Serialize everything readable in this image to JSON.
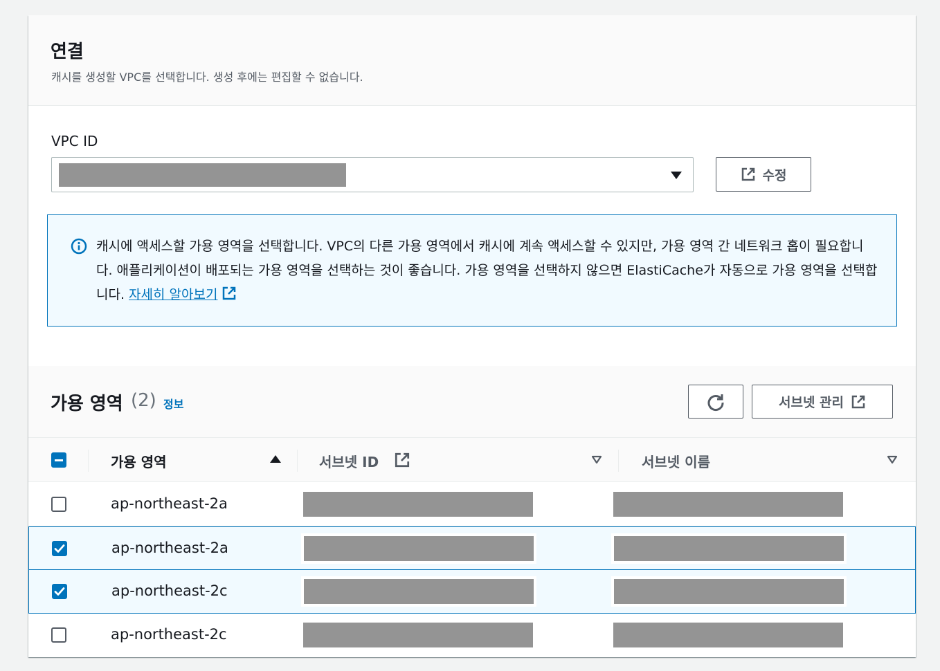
{
  "connection": {
    "title": "연결",
    "description": "캐시를 생성할 VPC를 선택합니다. 생성 후에는 편집할 수 없습니다."
  },
  "vpc": {
    "label": "VPC ID",
    "selected_value": "",
    "edit_button_label": "수정"
  },
  "info_alert": {
    "text": "캐시에 액세스할 가용 영역을 선택합니다. VPC의 다른 가용 영역에서 캐시에 계속 액세스할 수 있지만, 가용 영역 간 네트워크 홉이 필요합니다. 애플리케이션이 배포되는 가용 영역을 선택하는 것이 좋습니다. 가용 영역을 선택하지 않으면 ElastiCache가 자동으로 가용 영역을 선택합니다. ",
    "link_label": "자세히 알아보기"
  },
  "availability_zones": {
    "title": "가용 영역",
    "count": "(2)",
    "info_link": "정보",
    "manage_subnets_label": "서브넷 관리",
    "columns": [
      "가용 영역",
      "서브넷 ID",
      "서브넷 이름"
    ],
    "rows": [
      {
        "az": "ap-northeast-2a",
        "checked": false
      },
      {
        "az": "ap-northeast-2a",
        "checked": true
      },
      {
        "az": "ap-northeast-2c",
        "checked": true
      },
      {
        "az": "ap-northeast-2c",
        "checked": false
      }
    ]
  },
  "colors": {
    "accent": "#0073bb",
    "info_background": "#f1faff",
    "redacted": "#949494"
  },
  "icons": [
    "chevron-down-icon",
    "external-link-icon",
    "info-icon",
    "refresh-icon",
    "sort-ascending-icon",
    "sort-descending-icon",
    "checkbox-indeterminate",
    "checkbox-checked",
    "checkbox-unchecked"
  ]
}
